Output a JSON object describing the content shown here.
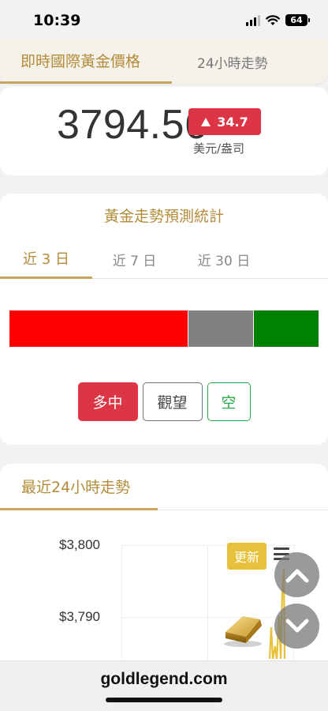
{
  "status_bar": {
    "time": "10:39",
    "battery": "64"
  },
  "top_tabs": [
    {
      "label": "即時國際黃金價格",
      "active": true
    },
    {
      "label": "24小時走勢",
      "active": false
    }
  ],
  "price": {
    "value": "3794.56",
    "change": "34.7",
    "change_icon": "triangle-up-icon",
    "unit": "美元/盎司"
  },
  "forecast": {
    "title": "黃金走勢預測統計",
    "periods": [
      {
        "label": "近 3 日",
        "active": true
      },
      {
        "label": "近 7 日",
        "active": false
      },
      {
        "label": "近 30 日",
        "active": false
      }
    ],
    "distribution": [
      {
        "name": "bullish",
        "share": 0.577,
        "color": "#ff0000"
      },
      {
        "name": "neutral",
        "share": 0.211,
        "color": "#808080"
      },
      {
        "name": "bearish",
        "share": 0.212,
        "color": "#008000"
      }
    ],
    "votes": {
      "bull": "多中",
      "hold": "觀望",
      "bear": "空"
    }
  },
  "trend": {
    "title": "最近24小時走勢",
    "y_ticks": [
      "$3,800",
      "$3,790"
    ],
    "update_label": "更新",
    "menu_icon": "hamburger-menu-icon"
  },
  "url_bar": {
    "domain": "goldlegend.com"
  },
  "colors": {
    "gold": "#b38b3a",
    "red": "#dc3545",
    "green": "#28a745",
    "yellow": "#e8c13c"
  }
}
